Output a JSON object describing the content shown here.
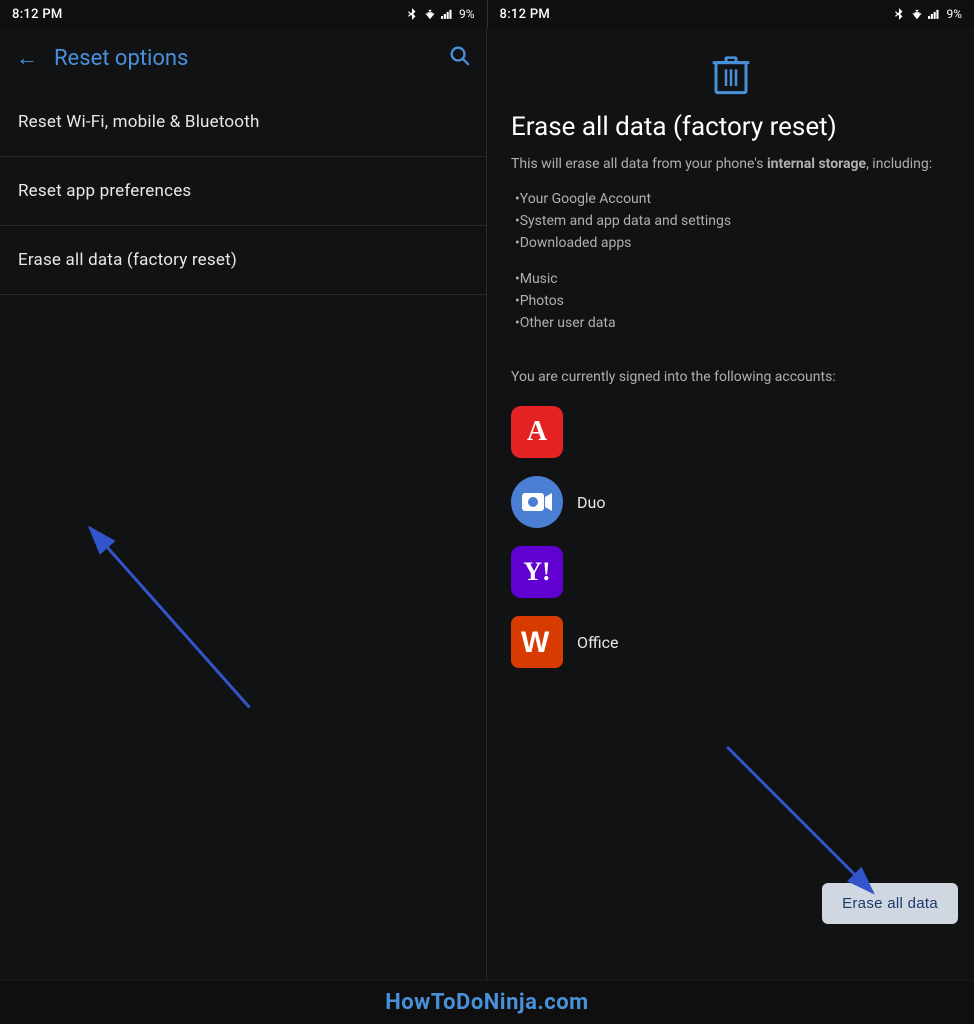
{
  "left_status": {
    "time": "8:12 PM",
    "icons": "🔵 ▼ 📶 9%"
  },
  "right_status": {
    "time": "8:12 PM",
    "icons": "🔵 ▼ 📶 9%"
  },
  "left_panel": {
    "back_label": "←",
    "title": "Reset options",
    "search_icon": "🔍",
    "menu_items": [
      "Reset Wi-Fi, mobile & Bluetooth",
      "Reset app preferences",
      "Erase all data (factory reset)"
    ]
  },
  "right_panel": {
    "trash_icon": "🗑",
    "title": "Erase all data (factory reset)",
    "description_prefix": "This will erase all data from your phone's ",
    "description_bold": "internal storage",
    "description_suffix": ", including:",
    "bullets": [
      "•Your Google Account",
      "•System and app data and settings",
      "•Downloaded apps",
      "•Music",
      "•Photos",
      "•Other user data"
    ],
    "signed_in_text": "You are currently signed into the following accounts:",
    "accounts": [
      {
        "name": "Adobe",
        "label": "",
        "type": "adobe"
      },
      {
        "name": "Duo",
        "label": "Duo",
        "type": "duo"
      },
      {
        "name": "Yahoo",
        "label": "",
        "type": "yahoo"
      },
      {
        "name": "Office",
        "label": "Office",
        "type": "office"
      }
    ],
    "erase_button_label": "Erase all data"
  },
  "watermark": "HowToDoNinja.com"
}
